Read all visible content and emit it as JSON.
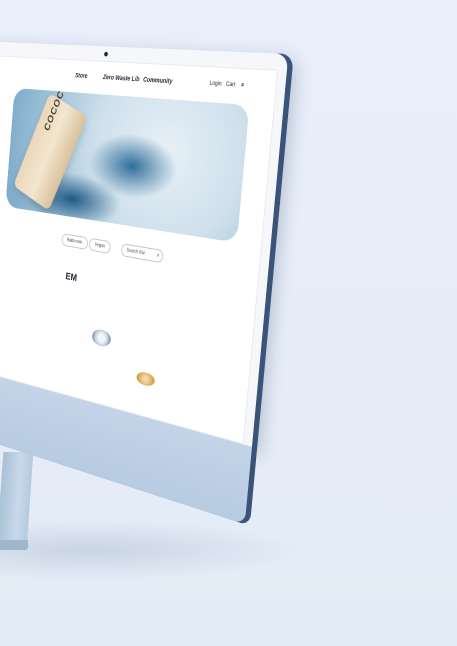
{
  "nav": {
    "items": [
      "Store",
      "Zero Waste Lib",
      "Community"
    ],
    "login": "Login",
    "cart": "Cart",
    "search_icon": "search-icon"
  },
  "hero": {
    "brand": "COCOCLUB"
  },
  "filters": {
    "pills": [
      "Bathroom",
      "Vegan"
    ],
    "search_placeholder": "Search Bar"
  },
  "section": {
    "title": "EM"
  }
}
